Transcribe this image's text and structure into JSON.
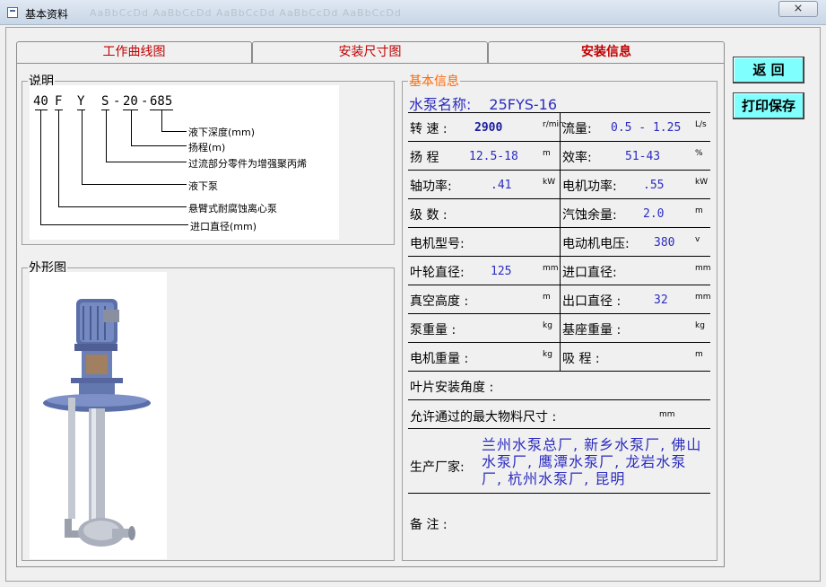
{
  "window": {
    "title": "基本资料",
    "close_glyph": "⨯",
    "ghost_text": "AaBbCcDd AaBbCcDd AaBbCcDd AaBbCcDd AaBbCcDd"
  },
  "tabs": [
    "工作曲线图",
    "安装尺寸图",
    "安装信息"
  ],
  "buttons": {
    "back": "返 回",
    "print_save": "打印保存"
  },
  "description": {
    "legend": "说明",
    "code": [
      "40",
      "F",
      "Y",
      "S",
      "-",
      "20",
      "-",
      "685"
    ],
    "labels": [
      "液下深度(mm)",
      "扬程(m)",
      "过流部分零件为增强聚丙烯",
      "液下泵",
      "悬臂式耐腐蚀离心泵",
      "进口直径(mm)"
    ]
  },
  "shape": {
    "legend": "外形图"
  },
  "info": {
    "legend": "基本信息",
    "pump_name_label": "水泵名称:",
    "pump_name": "25FYS-16",
    "rows": [
      {
        "lk": "转 速 :",
        "lv": "2900",
        "lu": "r/min",
        "rk": "流量:",
        "rv": "0.5 - 1.25",
        "ru": "L/s"
      },
      {
        "lk": "扬 程",
        "lv": "12.5-18",
        "lu": "m",
        "rk": "效率:",
        "rv": "51-43",
        "ru": "%"
      },
      {
        "lk": "轴功率:",
        "lv": ".41",
        "lu": "kW",
        "rk": "电机功率:",
        "rv": ".55",
        "ru": "kW"
      },
      {
        "lk": "级 数 :",
        "lv": "",
        "lu": "",
        "rk": "汽蚀余量:",
        "rv": "2.0",
        "ru": "m"
      },
      {
        "lk": "电机型号:",
        "lv": "",
        "lu": "",
        "rk": "电动机电压:",
        "rv": "380",
        "ru": "v"
      },
      {
        "lk": "叶轮直径:",
        "lv": "125",
        "lu": "mm",
        "rk": "进口直径:",
        "rv": "",
        "ru": "mm"
      },
      {
        "lk": "真空高度 :",
        "lv": "",
        "lu": "m",
        "rk": "出口直径 :",
        "rv": "32",
        "ru": "mm"
      },
      {
        "lk": "泵重量 :",
        "lv": "",
        "lu": "kg",
        "rk": "基座重量 :",
        "rv": "",
        "ru": "kg"
      },
      {
        "lk": "电机重量 :",
        "lv": "",
        "lu": "kg",
        "rk": "吸 程 :",
        "rv": "",
        "ru": "m"
      }
    ],
    "blade_angle_label": "叶片安装角度 :",
    "max_particle_label": "允许通过的最大物料尺寸 :",
    "max_particle_unit": "mm",
    "manufacturer_label": "生产厂家:",
    "manufacturer": "兰州水泵总厂, 新乡水泵厂, 佛山水泵厂, 鹰潭水泵厂, 龙岩水泵厂, 杭州水泵厂, 昆明",
    "remark_label": "备 注 :"
  }
}
